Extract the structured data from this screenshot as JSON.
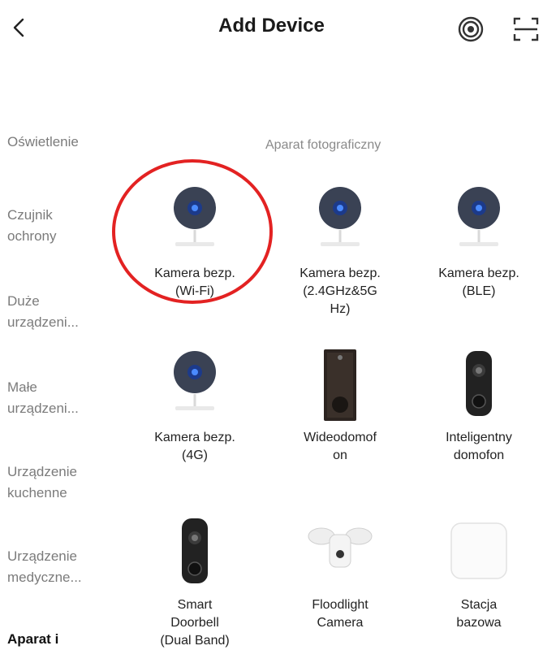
{
  "header": {
    "title": "Add Device"
  },
  "sidebar": {
    "items": [
      {
        "label": "Oświetlenie",
        "active": false
      },
      {
        "label": "Czujnik\nochrony",
        "active": false
      },
      {
        "label": "Duże\nurządzeni...",
        "active": false
      },
      {
        "label": "Małe\nurządzeni...",
        "active": false
      },
      {
        "label": "Urządzenie\nkuchenne",
        "active": false
      },
      {
        "label": "Urządzenie\nmedyczne...",
        "active": false
      },
      {
        "label": "Aparat i",
        "active": true
      }
    ]
  },
  "main": {
    "section_title": "Aparat fotograficzny",
    "devices": [
      {
        "name": "Kamera bezp.\n(Wi-Fi)",
        "icon": "security-camera-icon"
      },
      {
        "name": "Kamera bezp.\n(2.4GHz&5G\nHz)",
        "icon": "security-camera-icon"
      },
      {
        "name": "Kamera bezp.\n(BLE)",
        "icon": "security-camera-icon"
      },
      {
        "name": "Kamera bezp.\n(4G)",
        "icon": "security-camera-icon"
      },
      {
        "name": "Wideodomof\non",
        "icon": "video-intercom-icon"
      },
      {
        "name": "Inteligentny\ndomofon",
        "icon": "smart-doorbell-icon"
      },
      {
        "name": "Smart\nDoorbell\n(Dual Band)",
        "icon": "smart-doorbell-icon"
      },
      {
        "name": "Floodlight\nCamera",
        "icon": "floodlight-camera-icon"
      },
      {
        "name": "Stacja\nbazowa",
        "icon": "base-station-icon"
      }
    ]
  },
  "colors": {
    "highlight": "#e32222",
    "active_text": "#111111",
    "inactive_text": "#7b7b7b"
  }
}
